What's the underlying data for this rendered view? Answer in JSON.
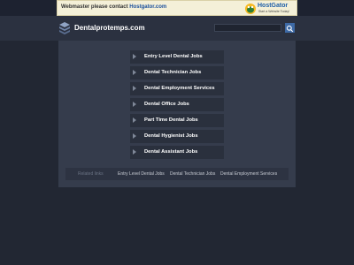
{
  "ad": {
    "text": "Webmaster please contact ",
    "link": "Hostgator.com",
    "logo_name": "HostGator",
    "logo_tagline": "Start a Website Today!"
  },
  "header": {
    "site_title": "Dentalprotemps.com",
    "search_placeholder": ""
  },
  "links": [
    {
      "label": "Entry Level Dental Jobs"
    },
    {
      "label": "Dental Technician Jobs"
    },
    {
      "label": "Dental Employment Services"
    },
    {
      "label": "Dental Office Jobs"
    },
    {
      "label": "Part Time Dental Jobs"
    },
    {
      "label": "Dental Hygienist Jobs"
    },
    {
      "label": "Dental Assistant Jobs"
    }
  ],
  "related": {
    "label": "Related links",
    "links": [
      "Entry Level Dental Jobs",
      "Dental Technician Jobs",
      "Dental Employment Services"
    ]
  },
  "colors": {
    "background": "#222733",
    "panel": "#353c4c",
    "accent": "#3e6aa6"
  },
  "icons": [
    "stack-icon",
    "search-icon",
    "arrow-icon",
    "gator-icon"
  ]
}
